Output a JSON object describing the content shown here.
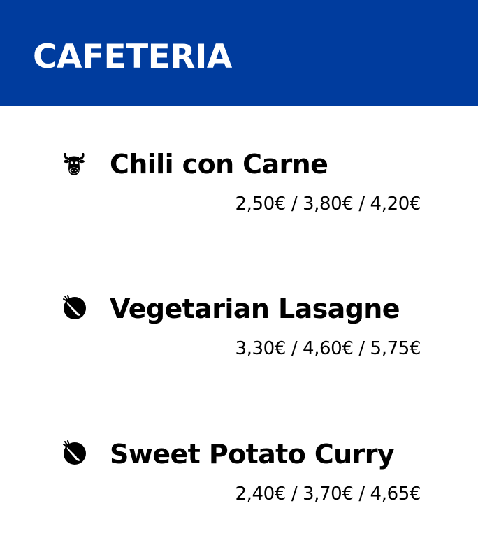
{
  "colors": {
    "header_background": "#003c9e",
    "header_text": "#ffffff",
    "page_background": "#ffffff",
    "text": "#000000"
  },
  "header": {
    "title": "CAFETERIA"
  },
  "menu": {
    "items": [
      {
        "name": "Chili con Carne",
        "price": "2,50€ / 3,80€ / 4,20€",
        "icon": "cow-icon"
      },
      {
        "name": "Vegetarian Lasagne",
        "price": "3,30€ / 4,60€ / 5,75€",
        "icon": "carrot-icon"
      },
      {
        "name": "Sweet Potato Curry",
        "price": "2,40€ / 3,70€ / 4,65€",
        "icon": "carrot-icon"
      }
    ]
  }
}
